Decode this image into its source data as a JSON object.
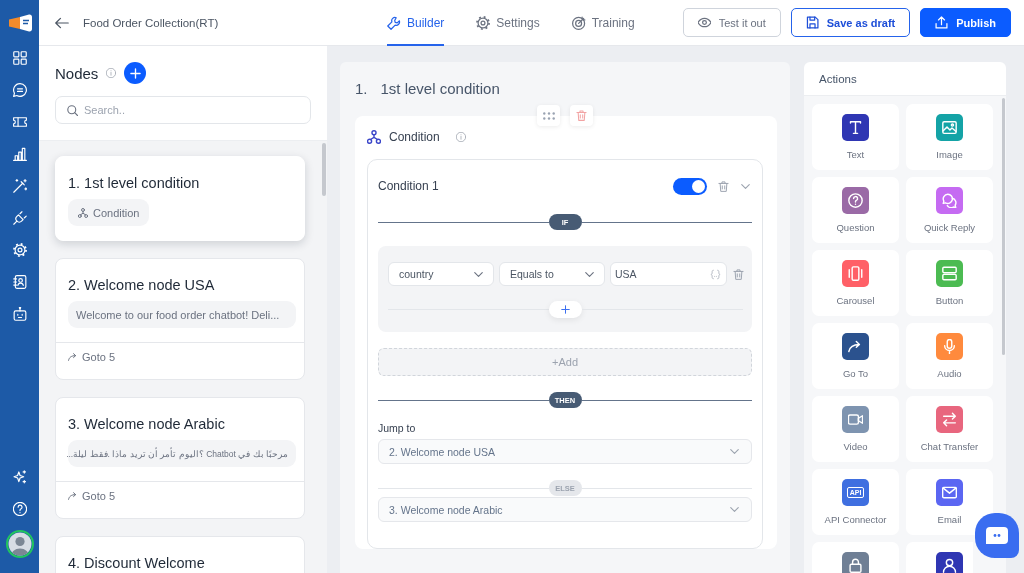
{
  "header": {
    "title": "Food Order Collection(RT)",
    "tabs": [
      {
        "label": "Builder",
        "selected": true
      },
      {
        "label": "Settings",
        "selected": false
      },
      {
        "label": "Training",
        "selected": false
      }
    ],
    "buttons": [
      {
        "label": "Test it out",
        "kind": "outline"
      },
      {
        "label": "Save as draft",
        "kind": "secondary"
      },
      {
        "label": "Publish",
        "kind": "primary"
      }
    ]
  },
  "nodes": {
    "title": "Nodes",
    "search": {
      "placeholder": "Search.."
    },
    "items": [
      {
        "title": "1. 1st level condition",
        "selected": true,
        "chip": {
          "kind": "condition",
          "text": "Condition"
        }
      },
      {
        "title": "2. Welcome node USA",
        "selected": false,
        "chip": {
          "kind": "message",
          "text": "Welcome to our food order chatbot! Deli..."
        },
        "goto": "Goto 5"
      },
      {
        "title": "3. Welcome node Arabic",
        "selected": false,
        "chip": {
          "kind": "message",
          "text": "مرحبًا بك في Chatbot ؟اليوم تأمر أن تريد ماذا .فقط ليلة..."
        },
        "goto": "Goto 5"
      },
      {
        "title": "4. Discount Welcome",
        "selected": false
      }
    ]
  },
  "canvas": {
    "number": "1.",
    "heading": "1st level condition",
    "block": {
      "title": "Condition",
      "conditions": [
        {
          "title": "Condition 1",
          "on": true,
          "if_label": "IF",
          "rules": [
            {
              "field": "country",
              "operator": "Equals to",
              "value": "USA"
            }
          ],
          "add_label": "+Add",
          "then_label": "THEN",
          "jump_label": "Jump to",
          "jump_target": "2. Welcome node USA",
          "else_label": "ELSE",
          "else_target": "3. Welcome node Arabic"
        }
      ]
    }
  },
  "actions": {
    "title": "Actions",
    "items": [
      {
        "kind": "text",
        "label": "Text",
        "color": "#2f36b3"
      },
      {
        "kind": "image",
        "label": "Image",
        "color": "#14a3a6"
      },
      {
        "kind": "question",
        "label": "Question",
        "color": "#9a6aa6"
      },
      {
        "kind": "quick_reply",
        "label": "Quick Reply",
        "color": "#c56bf2"
      },
      {
        "kind": "carousel",
        "label": "Carousel",
        "color": "#ff6067"
      },
      {
        "kind": "button",
        "label": "Button",
        "color": "#4cbb52"
      },
      {
        "kind": "goto",
        "label": "Go To",
        "color": "#2b528e"
      },
      {
        "kind": "audio",
        "label": "Audio",
        "color": "#ff8a3d"
      },
      {
        "kind": "video",
        "label": "Video",
        "color": "#7e94b0"
      },
      {
        "kind": "transfer",
        "label": "Chat Transfer",
        "color": "#e8667e"
      },
      {
        "kind": "api",
        "label": "API Connector",
        "color": "#3f6fe0",
        "glyph": "API"
      },
      {
        "kind": "email",
        "label": "Email",
        "color": "#5b66f2"
      },
      {
        "kind": "lock",
        "color": "#6f7f95"
      },
      {
        "kind": "user",
        "color": "#2f36b3"
      }
    ]
  }
}
